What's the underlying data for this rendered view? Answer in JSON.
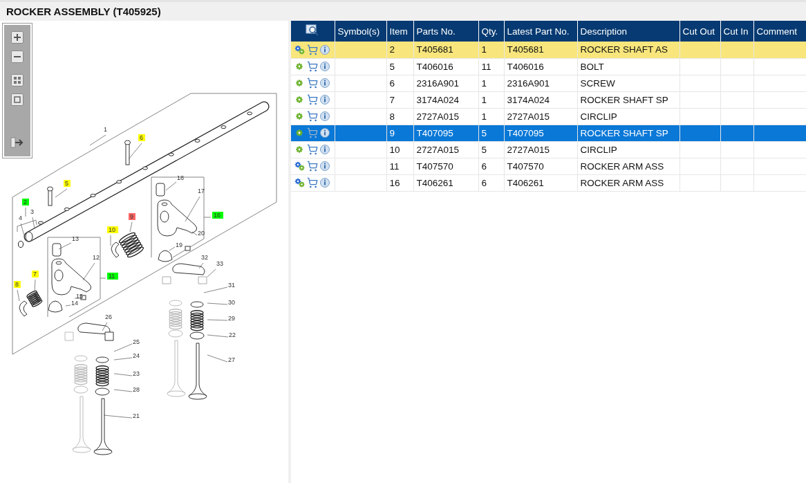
{
  "title": "ROCKER ASSEMBLY (T405925)",
  "callouts": [
    {
      "label": "1"
    },
    {
      "label": "6",
      "color": "#ffff00"
    },
    {
      "label": "5",
      "color": "#ffff00"
    },
    {
      "label": "2",
      "color": "#00ff00"
    },
    {
      "label": "3"
    },
    {
      "label": "4"
    },
    {
      "label": "18"
    },
    {
      "label": "17"
    },
    {
      "label": "16",
      "color": "#00ff00"
    },
    {
      "label": "20"
    },
    {
      "label": "9",
      "color": "#ff6666"
    },
    {
      "label": "10",
      "color": "#ffff00"
    },
    {
      "label": "13"
    },
    {
      "label": "12"
    },
    {
      "label": "19"
    },
    {
      "label": "11",
      "color": "#00ff00"
    },
    {
      "label": "7",
      "color": "#ffff00"
    },
    {
      "label": "8",
      "color": "#ffff00"
    },
    {
      "label": "15"
    },
    {
      "label": "14"
    },
    {
      "label": "32"
    },
    {
      "label": "33"
    },
    {
      "label": "31"
    },
    {
      "label": "30"
    },
    {
      "label": "29"
    },
    {
      "label": "22"
    },
    {
      "label": "27"
    },
    {
      "label": "26"
    },
    {
      "label": "25"
    },
    {
      "label": "24"
    },
    {
      "label": "23"
    },
    {
      "label": "28"
    },
    {
      "label": "21"
    }
  ],
  "table": {
    "columns": [
      "Symbol(s)",
      "Item",
      "Parts No.",
      "Qty.",
      "Latest Part No.",
      "Description",
      "Cut Out",
      "Cut In",
      "Comment"
    ],
    "rows": [
      {
        "kind": "assembly",
        "item": "2",
        "parts_no": "T405681",
        "qty": "1",
        "latest_part_no": "T405681",
        "description": "ROCKER SHAFT AS",
        "highlighted": true,
        "selected": false
      },
      {
        "kind": "part",
        "item": "5",
        "parts_no": "T406016",
        "qty": "11",
        "latest_part_no": "T406016",
        "description": "BOLT",
        "highlighted": false,
        "selected": false
      },
      {
        "kind": "part",
        "item": "6",
        "parts_no": "2316A901",
        "qty": "1",
        "latest_part_no": "2316A901",
        "description": "SCREW",
        "highlighted": false,
        "selected": false
      },
      {
        "kind": "part",
        "item": "7",
        "parts_no": "3174A024",
        "qty": "1",
        "latest_part_no": "3174A024",
        "description": "ROCKER SHAFT SP",
        "highlighted": false,
        "selected": false
      },
      {
        "kind": "part",
        "item": "8",
        "parts_no": "2727A015",
        "qty": "1",
        "latest_part_no": "2727A015",
        "description": "CIRCLIP",
        "highlighted": false,
        "selected": false
      },
      {
        "kind": "part",
        "item": "9",
        "parts_no": "T407095",
        "qty": "5",
        "latest_part_no": "T407095",
        "description": "ROCKER SHAFT SP",
        "highlighted": false,
        "selected": true
      },
      {
        "kind": "part",
        "item": "10",
        "parts_no": "2727A015",
        "qty": "5",
        "latest_part_no": "2727A015",
        "description": "CIRCLIP",
        "highlighted": false,
        "selected": false
      },
      {
        "kind": "assembly",
        "item": "11",
        "parts_no": "T407570",
        "qty": "6",
        "latest_part_no": "T407570",
        "description": "ROCKER ARM ASS",
        "highlighted": false,
        "selected": false
      },
      {
        "kind": "assembly",
        "item": "16",
        "parts_no": "T406261",
        "qty": "6",
        "latest_part_no": "T406261",
        "description": "ROCKER ARM ASS",
        "highlighted": false,
        "selected": false
      }
    ]
  }
}
